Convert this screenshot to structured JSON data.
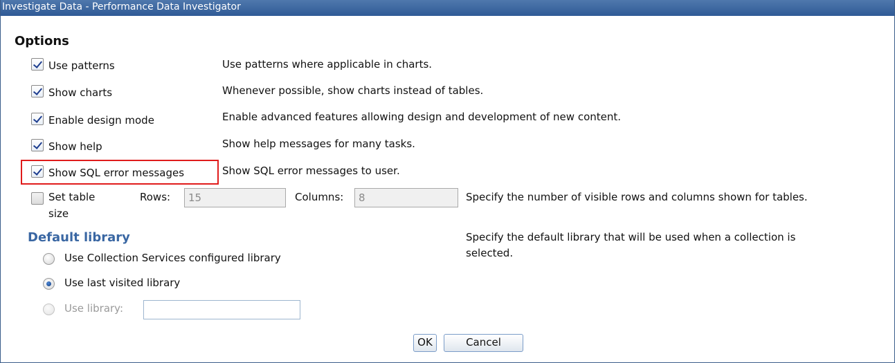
{
  "window": {
    "title": "Investigate Data - Performance Data Investigator"
  },
  "options": {
    "heading": "Options",
    "items": [
      {
        "label": "Use patterns",
        "description": "Use patterns where applicable in charts.",
        "checked": true
      },
      {
        "label": "Show charts",
        "description": "Whenever possible, show charts instead of tables.",
        "checked": true
      },
      {
        "label": "Enable design mode",
        "description": "Enable advanced features allowing design and development of new content.",
        "checked": true
      },
      {
        "label": "Show help",
        "description": "Show help messages for many tasks.",
        "checked": true
      },
      {
        "label": "Show SQL error messages",
        "description": "Show SQL error messages to user.",
        "checked": true
      }
    ],
    "table_size": {
      "label_line1": "Set table",
      "label_line2": "size",
      "checked": false,
      "rows_label": "Rows:",
      "rows_value": "15",
      "columns_label": "Columns:",
      "columns_value": "8",
      "description": "Specify the number of visible rows and columns shown for tables."
    }
  },
  "default_library": {
    "heading": "Default library",
    "description_line1": "Specify the default library that will be used when a collection is",
    "description_line2": "selected.",
    "choices": [
      {
        "label": "Use Collection Services configured library",
        "selected": false,
        "enabled": true
      },
      {
        "label": "Use last visited library",
        "selected": true,
        "enabled": true
      },
      {
        "label": "Use library:",
        "selected": false,
        "enabled": false
      }
    ],
    "library_value": ""
  },
  "buttons": {
    "ok": "OK",
    "cancel": "Cancel"
  },
  "colors": {
    "titlebar": "#2f5a96",
    "highlight": "#e01b1b",
    "section_blue": "#3a67a3"
  }
}
